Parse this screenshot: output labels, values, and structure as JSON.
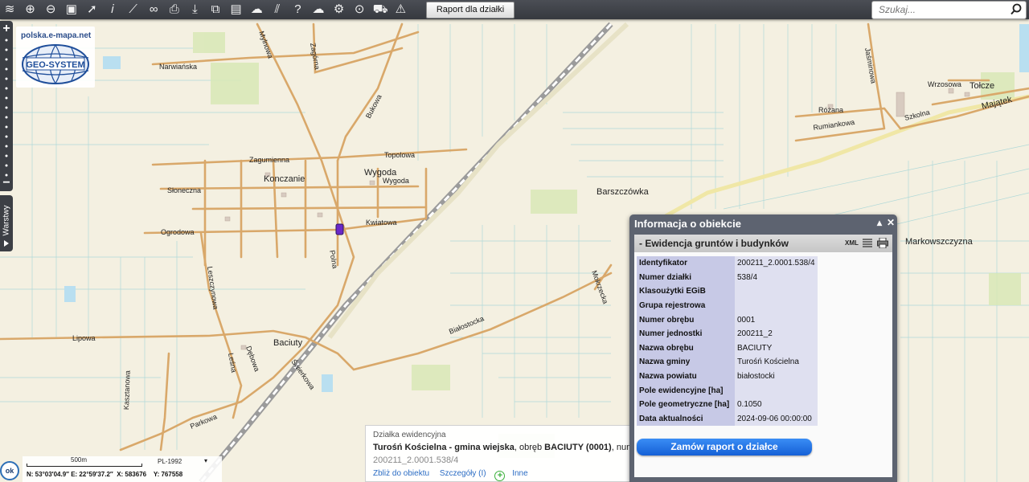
{
  "toolbar": {
    "report_button": "Raport dla działki",
    "search_placeholder": "Szukaj...",
    "icons": [
      "layers-icon",
      "zoom-in-icon",
      "zoom-out-icon",
      "zoom-extent-icon",
      "pointer-icon",
      "info-icon",
      "measure-icon",
      "link-icon",
      "print-icon",
      "download-icon",
      "export-icon",
      "layout-icon",
      "note-icon",
      "stripes-icon",
      "help-icon",
      "cloud-icon",
      "settings-icon",
      "find-icon",
      "cart-icon",
      "road-sign-icon"
    ]
  },
  "left_panel": {
    "layers_tab": "Warstwy"
  },
  "logo": {
    "url_text": "polska.e-mapa.net",
    "brand": "GEO-SYSTEM"
  },
  "scale": {
    "label": "500m",
    "crs": "PL-1992",
    "coords": "N: 53°03′04.9″ E: 22°59′37.2″  X: 583676    Y: 767558",
    "ok": "ok"
  },
  "map": {
    "place_labels": [
      "Konczanie",
      "Wygoda",
      "Barszczówka",
      "Markowszczyzna",
      "Tołcze",
      "Majątek",
      "Baciuty"
    ],
    "street_labels": [
      "Narwiańska",
      "Mylnowa",
      "Zagórna",
      "Bukowa",
      "Zagumienna",
      "Topolowa",
      "Słoneczna",
      "Wygoda",
      "Ogrodowa",
      "Kwiatowa",
      "Polna",
      "Lipowa",
      "Leszczynowa",
      "Białostocka",
      "Kasztanowa",
      "Parkowa",
      "Świerkowa",
      "Jaśminowa",
      "Wrzosowa",
      "Różana",
      "Rumiankowa",
      "Szkolna",
      "Mokrzecka",
      "Leśna",
      "Dębowa"
    ]
  },
  "parcel_strip": {
    "type_label": "Działka ewidencyjna",
    "gmina": "Turośń Kościelna - gmina wiejska",
    "obreb_prefix": ", obręb ",
    "obreb": "BACIUTY (0001)",
    "suffix": ", num",
    "id": "200211_2.0001.538/4",
    "link_zoom": "Zbliż do obiektu",
    "link_details": "Szczegóły (I)",
    "link_other": "Inne"
  },
  "info_panel": {
    "title": "Informacja o obiekcie",
    "section": "-  Ewidencja gruntów i budynków",
    "xml": "XML",
    "rows": [
      {
        "label": "Identyfikator",
        "value": "200211_2.0001.538/4"
      },
      {
        "label": "Numer działki",
        "value": "538/4"
      },
      {
        "label": "Klasoużytki EGiB",
        "value": ""
      },
      {
        "label": "Grupa rejestrowa",
        "value": ""
      },
      {
        "label": "Numer obrębu",
        "value": "0001"
      },
      {
        "label": "Numer jednostki",
        "value": "200211_2"
      },
      {
        "label": "Nazwa obrębu",
        "value": "BACIUTY"
      },
      {
        "label": "Nazwa gminy",
        "value": "Turośń Kościelna"
      },
      {
        "label": "Nazwa powiatu",
        "value": "białostocki"
      },
      {
        "label": "Pole ewidencyjne [ha]",
        "value": ""
      },
      {
        "label": "Pole geometryczne [ha]",
        "value": "0.1050"
      },
      {
        "label": "Data aktualności",
        "value": "2024-09-06 00:00:00"
      }
    ],
    "order_button": "Zamów raport o działce"
  },
  "colors": {
    "background": "#f4f0e1",
    "road": "#d9a86a",
    "railway": "#9a9a9a",
    "toolbar": "#3f4248",
    "panel_header": "#5d6370",
    "accent": "#1f6fe0"
  }
}
